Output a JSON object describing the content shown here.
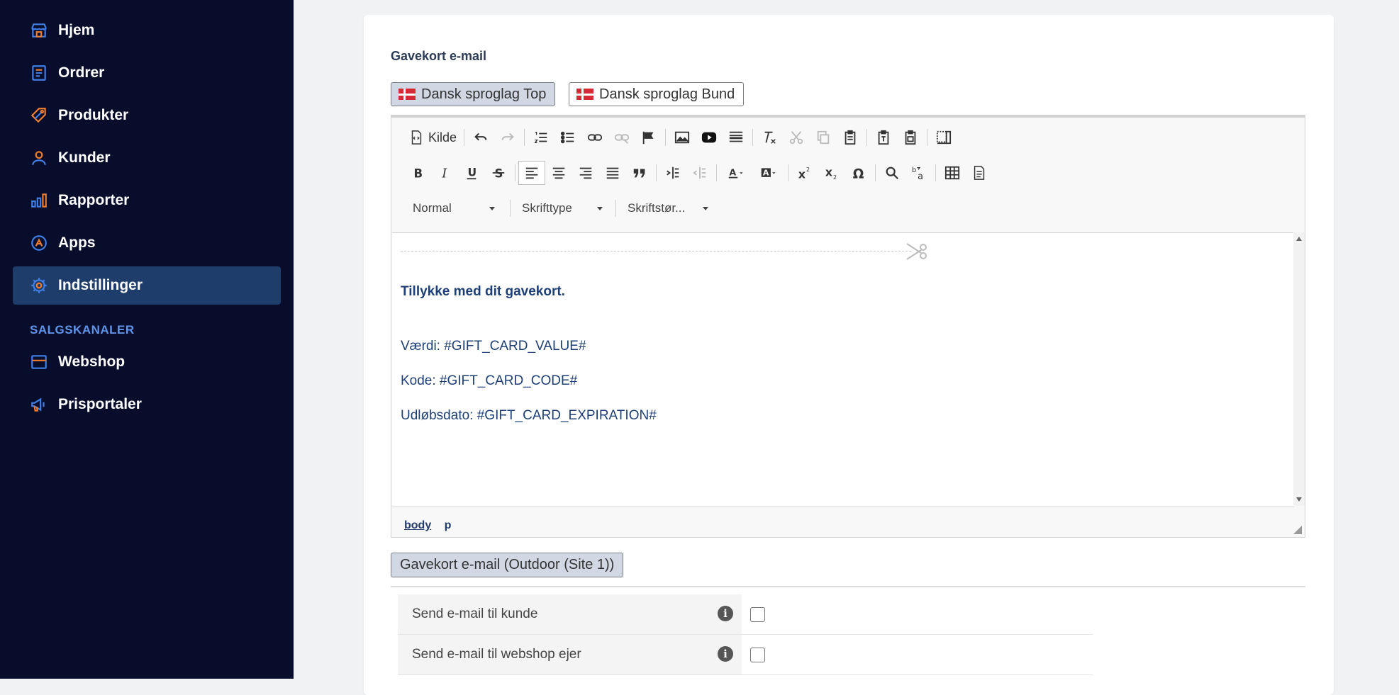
{
  "sidebar": {
    "items": [
      {
        "label": "Hjem",
        "icon": "store-icon"
      },
      {
        "label": "Ordrer",
        "icon": "receipt-icon"
      },
      {
        "label": "Produkter",
        "icon": "tag-icon"
      },
      {
        "label": "Kunder",
        "icon": "user-icon"
      },
      {
        "label": "Rapporter",
        "icon": "bar-chart-icon"
      },
      {
        "label": "Apps",
        "icon": "apps-icon"
      },
      {
        "label": "Indstillinger",
        "icon": "gear-icon"
      }
    ],
    "section_label": "SALGSKANALER",
    "channels": [
      {
        "label": "Webshop",
        "icon": "shop-icon"
      },
      {
        "label": "Prisportaler",
        "icon": "megaphone-icon"
      }
    ]
  },
  "card": {
    "title": "Gavekort e-mail",
    "lang_tabs": [
      {
        "label": "Dansk sproglag Top"
      },
      {
        "label": "Dansk sproglag Bund"
      }
    ]
  },
  "editor": {
    "source_label": "Kilde",
    "format_combo": "Normal",
    "font_combo": "Skrifttype",
    "size_combo": "Skriftstør...",
    "content": {
      "heading": "Tillykke med dit gavekort.",
      "line1": "Værdi: #GIFT_CARD_VALUE#",
      "line2": "Kode: #GIFT_CARD_CODE#",
      "line3": "Udløbsdato: #GIFT_CARD_EXPIRATION#"
    },
    "path": [
      "body",
      "p"
    ]
  },
  "site_tab": "Gavekort e-mail (Outdoor (Site 1))",
  "settings": [
    {
      "label": "Send e-mail til kunde"
    },
    {
      "label": "Send e-mail til webshop ejer"
    }
  ],
  "colors": {
    "sidebar_bg": "#080d2c",
    "active_bg": "#1f3d6b",
    "icon_blue": "#3f7fe6",
    "icon_orange": "#f07d2c"
  }
}
